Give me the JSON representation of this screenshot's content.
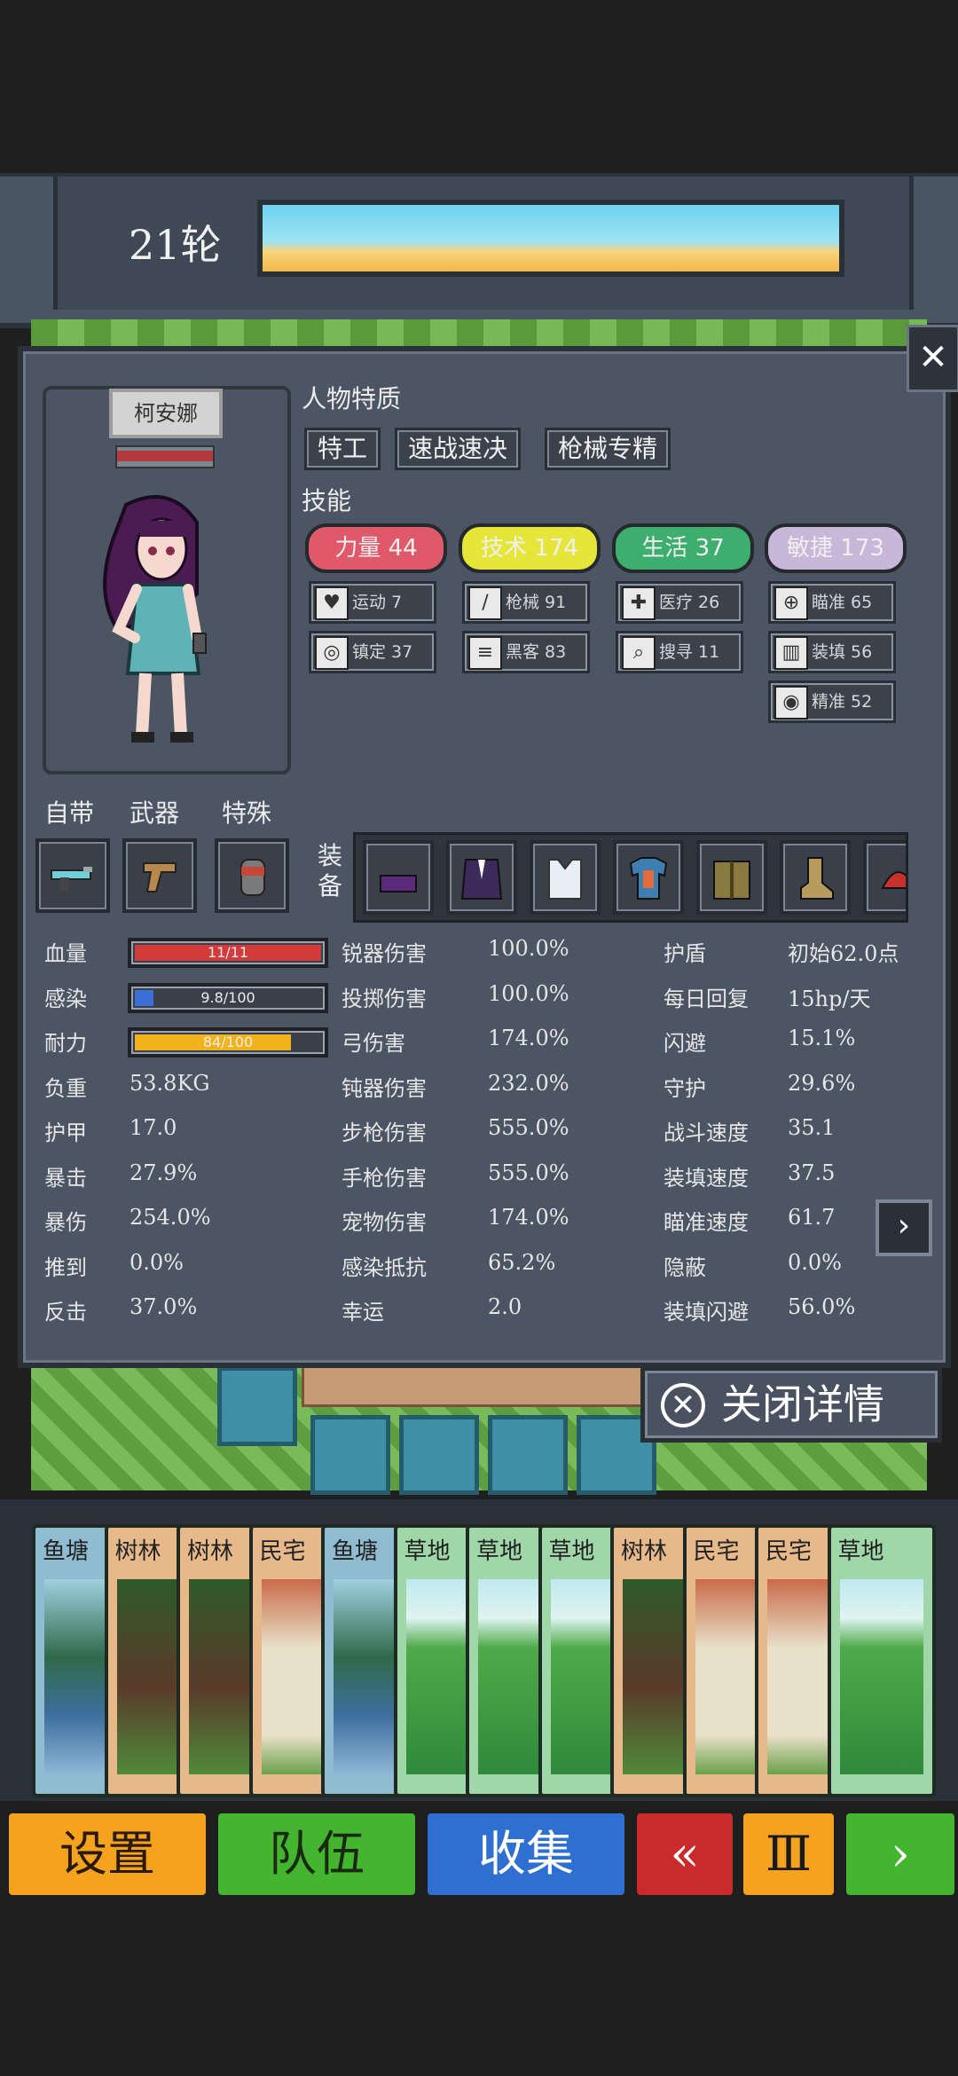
{
  "round": {
    "label": "21轮"
  },
  "panel": {
    "close_x": "✕",
    "character_name": "柯安娜",
    "traits_title": "人物特质",
    "traits": [
      "特工",
      "速战速决",
      "枪械专精"
    ],
    "skills_title": "技能",
    "skill_groups": [
      {
        "label": "力量 44",
        "color": "#e0596a",
        "subs": [
          {
            "icon": "heart-icon",
            "glyph": "♥",
            "label": "运动 7"
          },
          {
            "icon": "goggles-icon",
            "glyph": "◎",
            "label": "镇定 37"
          }
        ]
      },
      {
        "label": "技术 174",
        "color": "#e6e63a",
        "subs": [
          {
            "icon": "knife-icon",
            "glyph": "/",
            "label": "枪械 91"
          },
          {
            "icon": "circuit-icon",
            "glyph": "≡",
            "label": "黑客 83"
          }
        ]
      },
      {
        "label": "生活 37",
        "color": "#3eae6e",
        "subs": [
          {
            "icon": "medkit-icon",
            "glyph": "✚",
            "label": "医疗 26"
          },
          {
            "icon": "magnifier-icon",
            "glyph": "⌕",
            "label": "搜寻 11"
          }
        ]
      },
      {
        "label": "敏捷 173",
        "color": "#c8b7d8",
        "subs": [
          {
            "icon": "crosshair-icon",
            "glyph": "⊕",
            "label": "瞄准 65"
          },
          {
            "icon": "magazine-icon",
            "glyph": "▥",
            "label": "装填 56"
          },
          {
            "icon": "eye-icon",
            "glyph": "◉",
            "label": "精准 52"
          }
        ]
      }
    ],
    "slot_headers": [
      "自带",
      "武器",
      "特殊"
    ],
    "equipment_label": "装备",
    "stats_left": [
      {
        "label": "血量",
        "bar": true,
        "text": "11/11",
        "fill": 1.0,
        "color": "#d33a3a"
      },
      {
        "label": "感染",
        "bar": true,
        "text": "9.8/100",
        "fill": 0.098,
        "color": "#3c6fd6"
      },
      {
        "label": "耐力",
        "bar": true,
        "text": "84/100",
        "fill": 0.84,
        "color": "#f2b21c"
      },
      {
        "label": "负重",
        "value": "53.8KG"
      },
      {
        "label": "护甲",
        "value": "17.0"
      },
      {
        "label": "暴击",
        "value": "27.9%"
      },
      {
        "label": "暴伤",
        "value": "254.0%"
      },
      {
        "label": "推到",
        "value": "0.0%"
      },
      {
        "label": "反击",
        "value": "37.0%"
      }
    ],
    "stats_mid": [
      {
        "label": "锐器伤害",
        "value": "100.0%"
      },
      {
        "label": "投掷伤害",
        "value": "100.0%"
      },
      {
        "label": "弓伤害",
        "value": "174.0%"
      },
      {
        "label": "钝器伤害",
        "value": "232.0%"
      },
      {
        "label": "步枪伤害",
        "value": "555.0%"
      },
      {
        "label": "手枪伤害",
        "value": "555.0%"
      },
      {
        "label": "宠物伤害",
        "value": "174.0%"
      },
      {
        "label": "感染抵抗",
        "value": "65.2%"
      },
      {
        "label": "幸运",
        "value": "2.0"
      }
    ],
    "stats_right": [
      {
        "label": "护盾",
        "value": "初始62.0点"
      },
      {
        "label": "每日回复",
        "value": "15hp/天"
      },
      {
        "label": "闪避",
        "value": "15.1%"
      },
      {
        "label": "守护",
        "value": "29.6%"
      },
      {
        "label": "战斗速度",
        "value": "35.1"
      },
      {
        "label": "装填速度",
        "value": "37.5"
      },
      {
        "label": "瞄准速度",
        "value": "61.7"
      },
      {
        "label": "隐蔽",
        "value": "0.0%"
      },
      {
        "label": "装填闪避",
        "value": "56.0%"
      }
    ],
    "close_details": "关闭详情"
  },
  "cards": [
    {
      "title": "鱼塘",
      "frame": "#8fbcd0",
      "img": "pond"
    },
    {
      "title": "树林",
      "frame": "#e7b88a",
      "img": "forest"
    },
    {
      "title": "树林",
      "frame": "#e7b88a",
      "img": "forest"
    },
    {
      "title": "民宅",
      "frame": "#e7b88a",
      "img": "house"
    },
    {
      "title": "鱼塘",
      "frame": "#8fbcd0",
      "img": "pond"
    },
    {
      "title": "草地",
      "frame": "#9fd7a8",
      "img": "grass"
    },
    {
      "title": "草地",
      "frame": "#9fd7a8",
      "img": "grass"
    },
    {
      "title": "草地",
      "frame": "#9fd7a8",
      "img": "grass"
    },
    {
      "title": "树林",
      "frame": "#e7b88a",
      "img": "forest"
    },
    {
      "title": "民宅",
      "frame": "#e7b88a",
      "img": "house"
    },
    {
      "title": "民宅",
      "frame": "#e7b88a",
      "img": "house"
    },
    {
      "title": "草地",
      "frame": "#9fd7a8",
      "img": "grass"
    }
  ],
  "bottom": {
    "settings": "设置",
    "team": "队伍",
    "collect": "收集",
    "rewind": "«",
    "pause": "Ⅲ",
    "next": "›"
  }
}
